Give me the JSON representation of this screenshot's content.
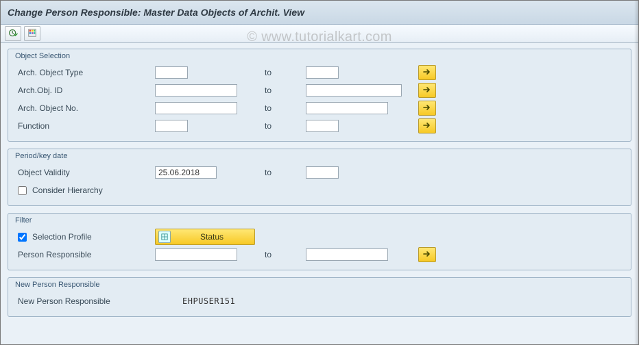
{
  "watermark": "© www.tutorialkart.com",
  "title": "Change Person Responsible: Master Data Objects of Archit. View",
  "labels": {
    "to": "to"
  },
  "groups": {
    "object_selection": {
      "title": "Object Selection",
      "rows": {
        "arch_obj_type": {
          "label": "Arch. Object Type",
          "from": "",
          "to": ""
        },
        "arch_obj_id": {
          "label": "Arch.Obj. ID",
          "from": "",
          "to": ""
        },
        "arch_obj_no": {
          "label": "Arch. Object No.",
          "from": "",
          "to": ""
        },
        "function": {
          "label": "Function",
          "from": "",
          "to": ""
        }
      }
    },
    "period": {
      "title": "Period/key date",
      "object_validity": {
        "label": "Object Validity",
        "from": "25.06.2018",
        "to": ""
      },
      "consider_hierarchy": {
        "label": "Consider Hierarchy",
        "checked": false
      }
    },
    "filter": {
      "title": "Filter",
      "selection_profile": {
        "label": "Selection Profile",
        "checked": true,
        "button_label": "Status"
      },
      "person_responsible": {
        "label": "Person Responsible",
        "from": "",
        "to": ""
      }
    },
    "new_person": {
      "title": "New Person Responsible",
      "row": {
        "label": "New Person Responsible",
        "value": "EHPUSER151"
      }
    }
  }
}
